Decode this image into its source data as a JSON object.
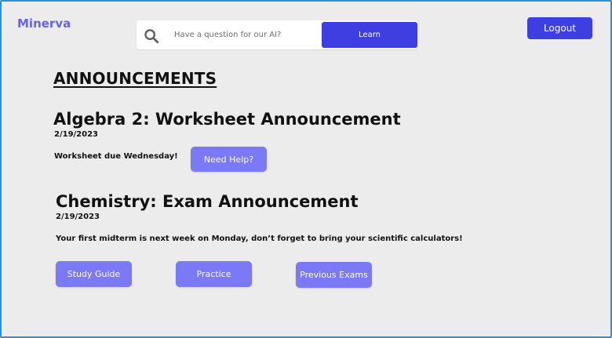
{
  "colors": {
    "brand": "#6b63e6",
    "accent": "#3f3ee0",
    "button": "#7b79f5",
    "background": "#ececec"
  },
  "header": {
    "brand": "Minerva",
    "search": {
      "icon": "search-icon",
      "placeholder": "Have a question for our AI?",
      "value": ""
    },
    "learn_label": "Learn",
    "logout_label": "Logout"
  },
  "page": {
    "title": "ANNOUNCEMENTS"
  },
  "announcements": [
    {
      "title": "Algebra 2: Worksheet Announcement",
      "date": "2/19/2023",
      "body": "Worksheet due Wednesday!",
      "actions": [
        "Need Help?"
      ]
    },
    {
      "title": "Chemistry: Exam Announcement",
      "date": "2/19/2023",
      "body": "Your first midterm is next week on Monday, don’t forget to bring your scientific calculators!",
      "actions": [
        "Study Guide",
        "Practice",
        "Previous Exams"
      ]
    }
  ]
}
